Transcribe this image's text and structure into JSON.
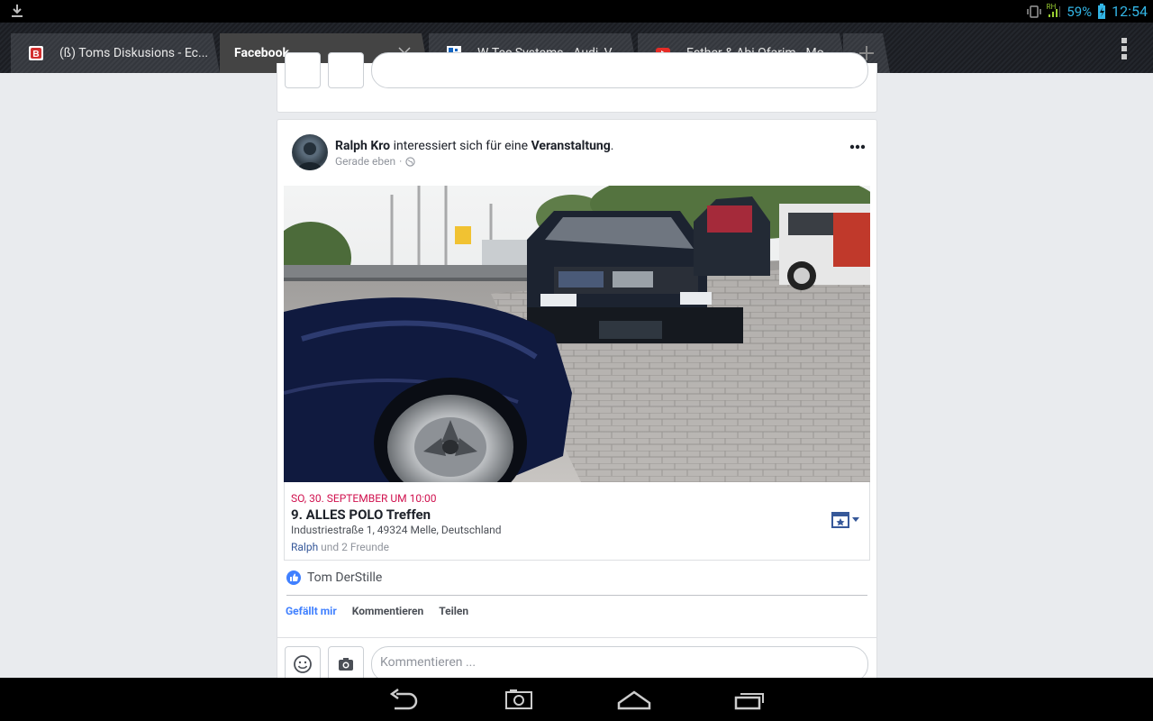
{
  "status_bar": {
    "battery_percent": "59%",
    "time": "12:54",
    "network_label": "RH",
    "icons": [
      "download-icon",
      "vibrate-icon",
      "signal-icon",
      "battery-charging-icon"
    ]
  },
  "tabs": [
    {
      "title": "(ß) Toms Diskusions - Ec...",
      "favicon": "blog-favicon",
      "active": false
    },
    {
      "title": "Facebook",
      "favicon": "",
      "active": true
    },
    {
      "title": "W-Tec Systems - Audi, V...",
      "favicon": "puzzle-favicon",
      "active": false
    },
    {
      "title": "Esther & Abi Ofarim - Mo...",
      "favicon": "youtube-favicon",
      "active": false
    }
  ],
  "post": {
    "author": "Ralph Kro",
    "action_text": " interessiert sich für eine ",
    "object": "Veranstaltung",
    "period": ".",
    "time": "Gerade eben",
    "time_sep": "·"
  },
  "event": {
    "date": "SO, 30. SEPTEMBER UM 10:00",
    "title": "9. ALLES POLO Treffen",
    "address": "Industriestraße 1, 49324 Melle, Deutschland",
    "friend_link": "Ralph",
    "friends_rest": " und 2 Freunde"
  },
  "reactions": {
    "liker": "Tom DerStille"
  },
  "actions": {
    "like": "Gefällt mir",
    "comment": "Kommentieren",
    "share": "Teilen"
  },
  "comment_box": {
    "placeholder": "Kommentieren ..."
  },
  "colors": {
    "accent": "#4080ff",
    "event_date": "#d0124f",
    "status_icons": "#33b5e5"
  }
}
